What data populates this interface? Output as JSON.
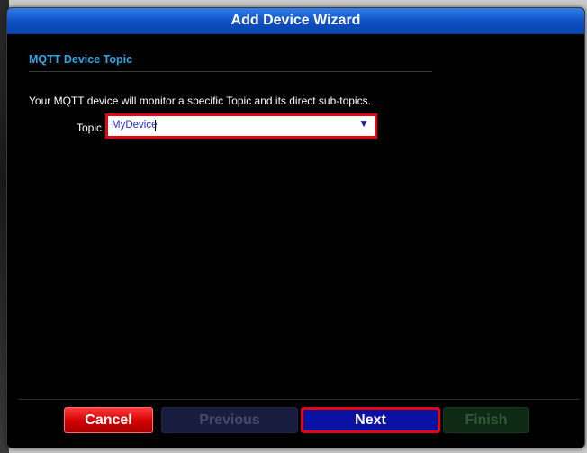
{
  "window": {
    "title": "Add Device Wizard"
  },
  "section": {
    "title": "MQTT Device Topic",
    "description": "Your MQTT device will monitor a specific Topic and its direct sub-topics."
  },
  "topic": {
    "label": "Topic",
    "value": "MyDevice",
    "dropdown_icon": "triangle-down-icon"
  },
  "buttons": {
    "cancel": "Cancel",
    "previous": "Previous",
    "next": "Next",
    "finish": "Finish"
  },
  "colors": {
    "titlebar": "#1259d6",
    "section_title": "#2aa7e6",
    "cancel": "#d10000",
    "next": "#0a12a3",
    "highlight": "#e30613"
  }
}
